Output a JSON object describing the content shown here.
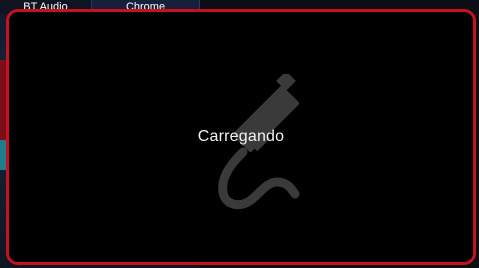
{
  "background": {
    "apps": [
      {
        "label": "BT Audio"
      },
      {
        "label": "Chrome"
      }
    ]
  },
  "modal": {
    "status_text": "Carregando",
    "icon": "usb-cable-plug-icon",
    "border_color": "#c8101e",
    "background_color": "#000000"
  }
}
